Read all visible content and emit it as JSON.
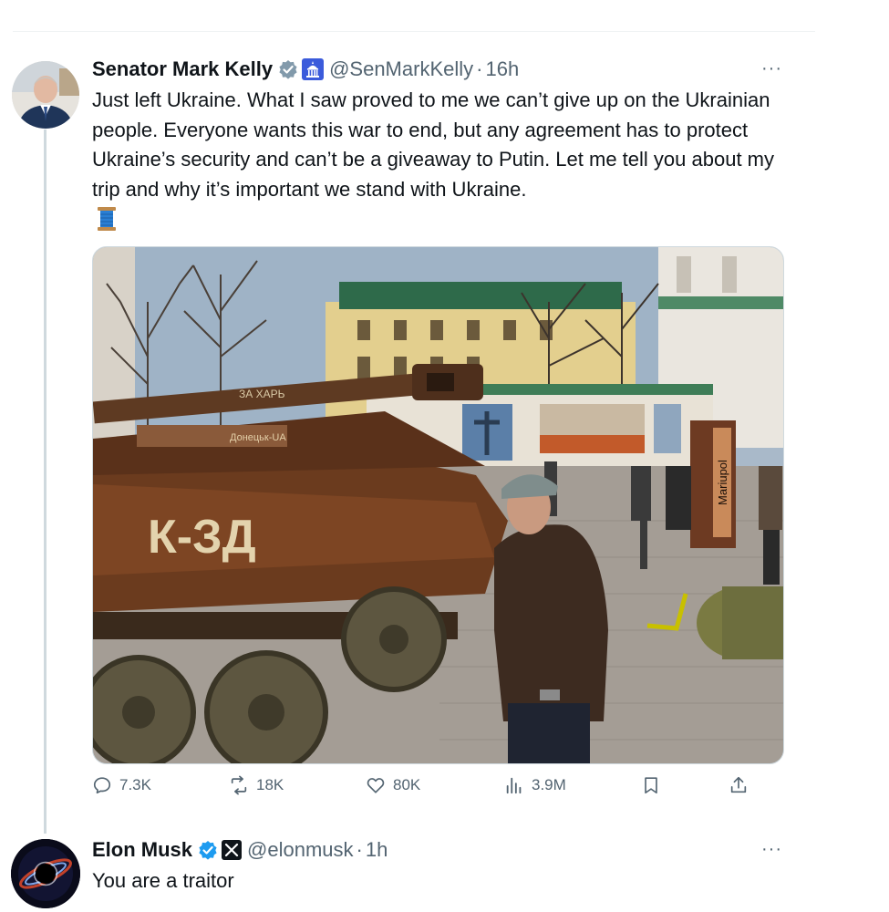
{
  "tweets": [
    {
      "author_name": "Senator Mark Kelly",
      "handle": "@SenMarkKelly",
      "separator": "·",
      "time": "16h",
      "more": "···",
      "text": "Just left Ukraine. What I saw proved to me we can’t give up on the Ukrainian people. Everyone wants this war to end, but any agreement has to protect Ukraine’s security and can’t be a giveaway to Putin. Let me tell you about my trip and why it’s important we stand with Ukraine.",
      "emoji_icon": "thread-spool-icon",
      "badges": [
        "verified-badge-gray",
        "government-capitol-badge"
      ],
      "media": {
        "description_icon": "photo",
        "texts": {
          "sign": "Mariupol",
          "tank_graffiti": "К-ЗД",
          "turret_graffiti": "ЗА ХАРЬ",
          "plate": "Донецьк-UA"
        }
      },
      "stats": {
        "replies": "7.3K",
        "reposts": "18K",
        "likes": "80K",
        "views": "3.9M"
      }
    },
    {
      "author_name": "Elon Musk",
      "handle": "@elonmusk",
      "separator": "·",
      "time": "1h",
      "more": "···",
      "text": "You are a traitor",
      "badges": [
        "verified-badge-blue",
        "x-affiliate-badge"
      ]
    }
  ],
  "colors": {
    "text_primary": "#0f1419",
    "text_secondary": "#536471",
    "verified_blue": "#1d9bf0",
    "verified_gray": "#829aab",
    "divider": "#eff3f4"
  }
}
